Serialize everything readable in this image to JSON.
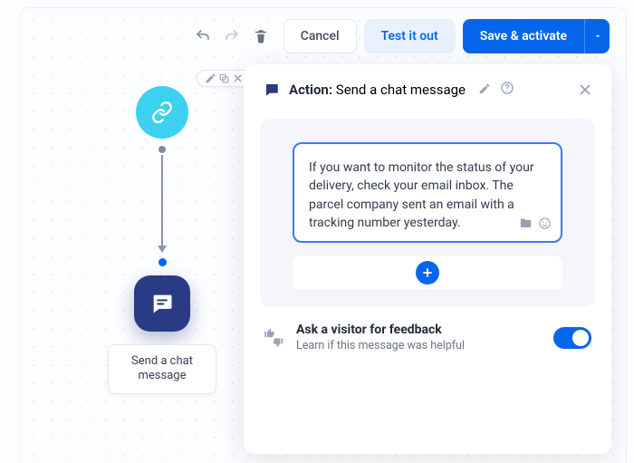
{
  "toolbar": {
    "cancel": "Cancel",
    "test": "Test it out",
    "save": "Save & activate"
  },
  "flow": {
    "action_label": "Send a chat message"
  },
  "panel": {
    "action_prefix": "Action:",
    "action_name": "Send a chat message",
    "message": "If you want to monitor the status of your delivery, check your email inbox. The parcel company sent an email with a tracking number yesterday.",
    "feedback_title": "Ask a visitor for feedback",
    "feedback_sub": "Learn if this message was helpful",
    "feedback_on": true
  }
}
